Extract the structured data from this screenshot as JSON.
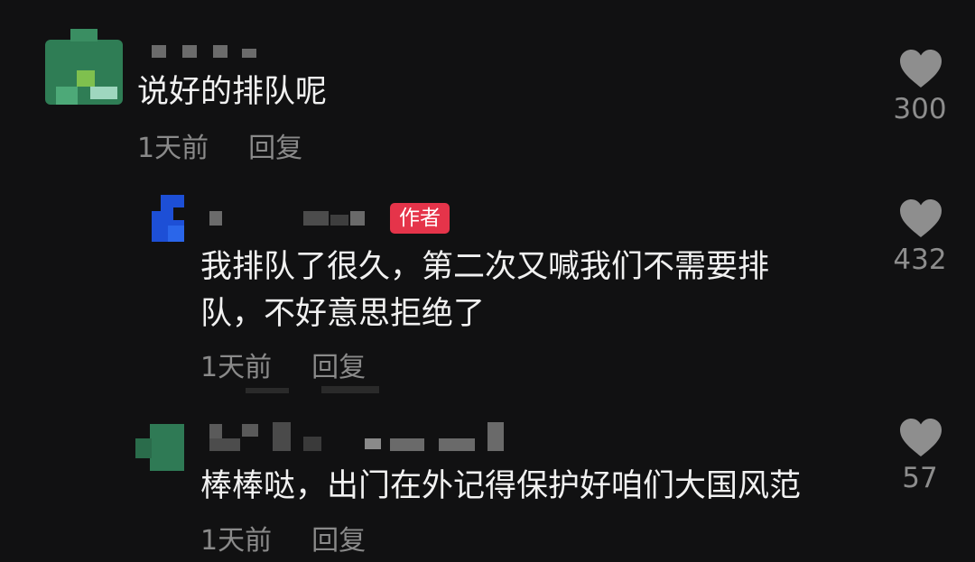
{
  "comments": [
    {
      "text": "说好的排队呢",
      "time": "1天前",
      "reply_label": "回复",
      "likes": "300"
    },
    {
      "badge": "作者",
      "text_lines": [
        "我排队了很久，第二次又喊我们不需要排",
        "队，不好意思拒绝了"
      ],
      "time": "1天前",
      "reply_label": "回复",
      "likes": "432"
    },
    {
      "text": "棒棒哒，出门在外记得保护好咱们大国风范",
      "time": "1天前",
      "reply_label": "回复",
      "likes": "57"
    }
  ],
  "icons": {
    "like": "heart-icon"
  },
  "colors": {
    "background": "#111112",
    "author_badge": "#e5344a",
    "secondary_text": "#8a8a8a"
  }
}
